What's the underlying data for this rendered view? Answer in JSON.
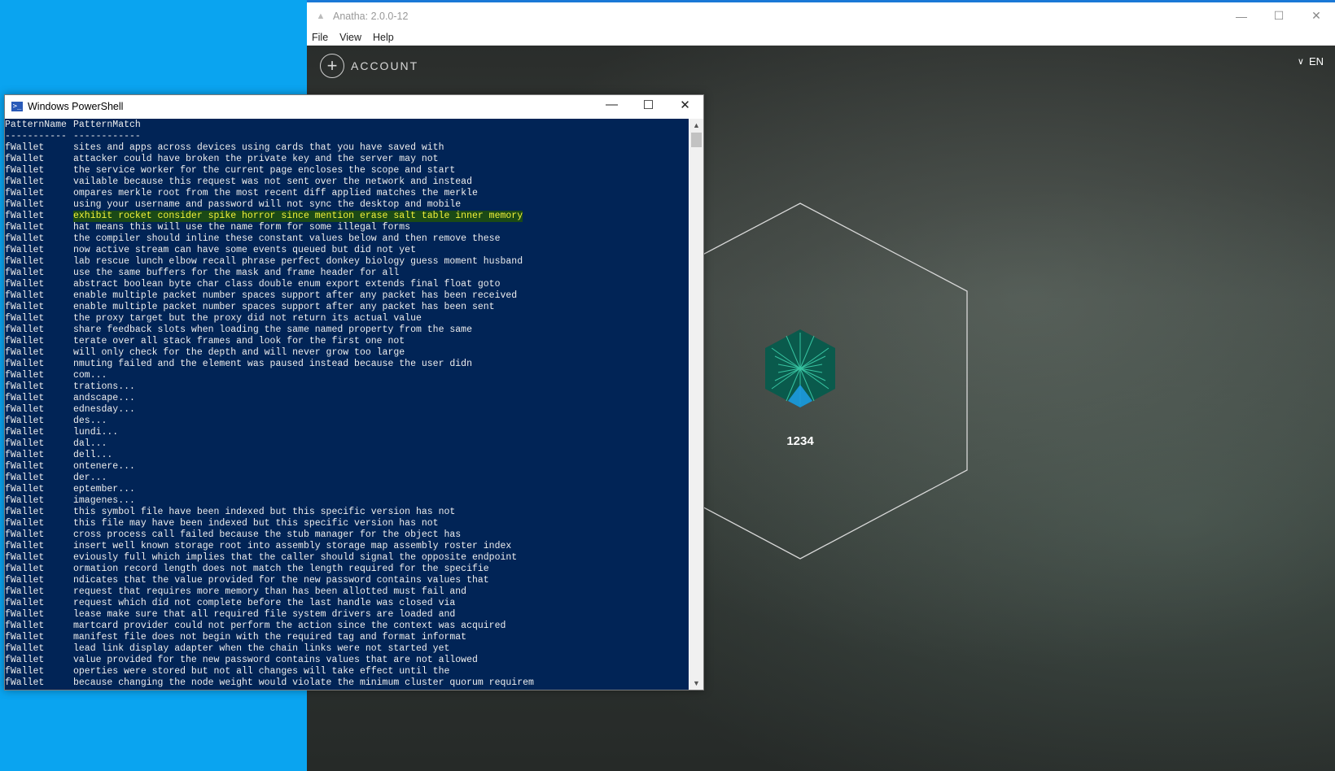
{
  "anatha": {
    "title": "Anatha: 2.0.0-12",
    "controls": {
      "minimize": "—",
      "maximize": "☐",
      "close": "✕"
    },
    "menu": [
      "File",
      "View",
      "Help"
    ],
    "account_label": "ACCOUNT",
    "plus_symbol": "+",
    "lang_label": "EN",
    "wallet_name": "1234"
  },
  "powershell": {
    "title": "Windows PowerShell",
    "controls": {
      "minimize": "—",
      "maximize": "☐",
      "close": "✕"
    },
    "headers": [
      "PatternName",
      "PatternMatch"
    ],
    "separators": [
      "-----------",
      "------------"
    ],
    "highlight_row_index": 6,
    "rows": [
      [
        "fWallet",
        "sites and apps across devices using cards that you have saved with"
      ],
      [
        "fWallet",
        "attacker could have broken the private key and the server may not"
      ],
      [
        "fWallet",
        "the service worker for the current page encloses the scope and start"
      ],
      [
        "fWallet",
        "vailable because this request was not sent over the network and instead"
      ],
      [
        "fWallet",
        "ompares merkle root from the most recent diff applied matches the merkle"
      ],
      [
        "fWallet",
        "using your username and password will not sync the desktop and mobile"
      ],
      [
        "fWallet",
        "exhibit rocket consider spike horror since mention erase salt table inner memory"
      ],
      [
        "fWallet",
        "hat means this will use the name form for some illegal forms"
      ],
      [
        "fWallet",
        "the compiler should inline these constant values below and then remove these"
      ],
      [
        "fWallet",
        "now active stream can have some events queued but did not yet"
      ],
      [
        "fWallet",
        "lab rescue lunch elbow recall phrase perfect donkey biology guess moment husband"
      ],
      [
        "fWallet",
        "use the same buffers for the mask and frame header for all"
      ],
      [
        "fWallet",
        "abstract boolean byte char class double enum export extends final float goto"
      ],
      [
        "fWallet",
        "enable multiple packet number spaces support after any packet has been received"
      ],
      [
        "fWallet",
        "enable multiple packet number spaces support after any packet has been sent"
      ],
      [
        "fWallet",
        "the proxy target but the proxy did not return its actual value"
      ],
      [
        "fWallet",
        "share feedback slots when loading the same named property from the same"
      ],
      [
        "fWallet",
        "terate over all stack frames and look for the first one not"
      ],
      [
        "fWallet",
        "will only check for the depth and will never grow too large"
      ],
      [
        "fWallet",
        "nmuting failed and the element was paused instead because the user didn"
      ],
      [
        "fWallet",
        "com..."
      ],
      [
        "fWallet",
        "trations..."
      ],
      [
        "fWallet",
        "andscape..."
      ],
      [
        "fWallet",
        "ednesday..."
      ],
      [
        "fWallet",
        "des..."
      ],
      [
        "fWallet",
        "lundi..."
      ],
      [
        "fWallet",
        "dal..."
      ],
      [
        "fWallet",
        "dell..."
      ],
      [
        "fWallet",
        "ontenere..."
      ],
      [
        "fWallet",
        "der..."
      ],
      [
        "fWallet",
        "eptember..."
      ],
      [
        "fWallet",
        "imagenes..."
      ],
      [
        "fWallet",
        "this symbol file have been indexed but this specific version has not"
      ],
      [
        "fWallet",
        "this file may have been indexed but this specific version has not"
      ],
      [
        "fWallet",
        "cross process call failed because the stub manager for the object has"
      ],
      [
        "fWallet",
        "insert well known storage root into assembly storage map assembly roster index"
      ],
      [
        "fWallet",
        "eviously full which implies that the caller should signal the opposite endpoint"
      ],
      [
        "fWallet",
        "ormation record length does not match the length required for the specifie"
      ],
      [
        "fWallet",
        "ndicates that the value provided for the new password contains values that"
      ],
      [
        "fWallet",
        "request that requires more memory than has been allotted must fail and"
      ],
      [
        "fWallet",
        "request which did not complete before the last handle was closed via"
      ],
      [
        "fWallet",
        "lease make sure that all required file system drivers are loaded and"
      ],
      [
        "fWallet",
        "martcard provider could not perform the action since the context was acquired"
      ],
      [
        "fWallet",
        "manifest file does not begin with the required tag and format informat"
      ],
      [
        "fWallet",
        "lead link display adapter when the chain links were not started yet"
      ],
      [
        "fWallet",
        "value provided for the new password contains values that are not allowed"
      ],
      [
        "fWallet",
        "operties were stored but not all changes will take effect until the"
      ],
      [
        "fWallet",
        "because changing the node weight would violate the minimum cluster quorum requirem"
      ]
    ]
  }
}
